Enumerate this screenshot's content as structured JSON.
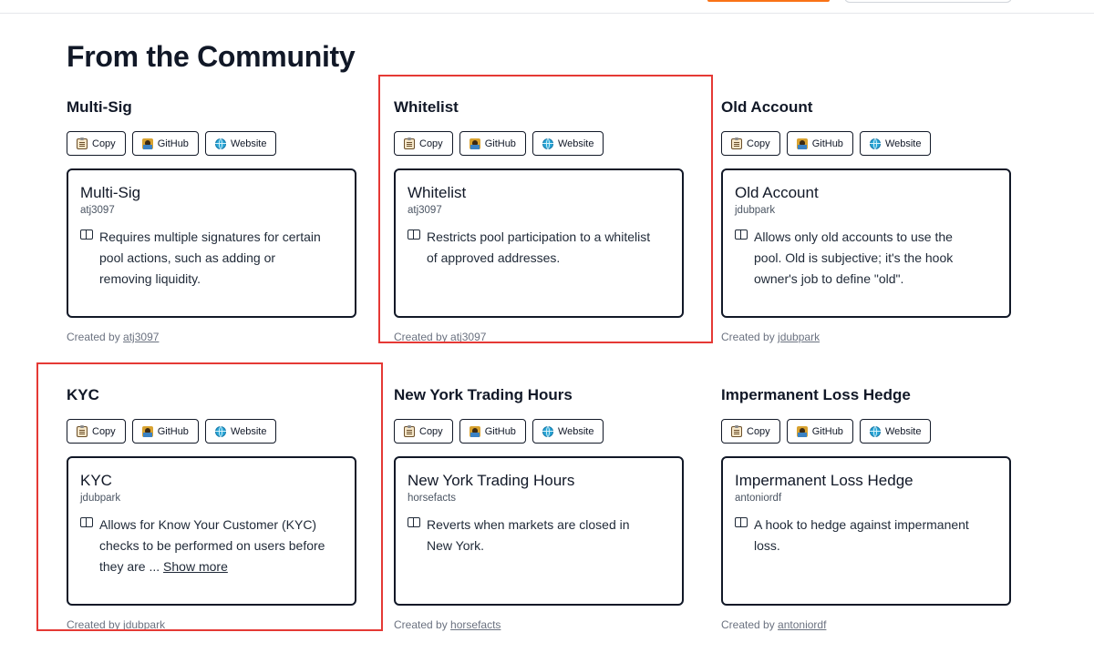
{
  "page": {
    "title": "From the Community"
  },
  "cards": [
    {
      "title": "Multi-Sig",
      "name": "Multi-Sig",
      "author": "atj3097",
      "description": "Requires multiple signatures for certain pool actions, such as adding or removing liquidity.",
      "show_more": "",
      "created_prefix": "Created by",
      "created_by": "atj3097",
      "buttons": {
        "copy": "Copy",
        "github": "GitHub",
        "website": "Website"
      }
    },
    {
      "title": "Whitelist",
      "name": "Whitelist",
      "author": "atj3097",
      "description": "Restricts pool participation to a whitelist of approved addresses.",
      "show_more": "",
      "created_prefix": "Created by",
      "created_by": "atj3097",
      "buttons": {
        "copy": "Copy",
        "github": "GitHub",
        "website": "Website"
      }
    },
    {
      "title": "Old Account",
      "name": "Old Account",
      "author": "jdubpark",
      "description": "Allows only old accounts to use the pool. Old is subjective; it's the hook owner's job to define \"old\".",
      "show_more": "",
      "created_prefix": "Created by",
      "created_by": "jdubpark",
      "buttons": {
        "copy": "Copy",
        "github": "GitHub",
        "website": "Website"
      }
    },
    {
      "title": "KYC",
      "name": "KYC",
      "author": "jdubpark",
      "description": "Allows for Know Your Customer (KYC) checks to be performed on users before they are ...",
      "show_more": "Show more",
      "created_prefix": "Created by",
      "created_by": "jdubpark",
      "buttons": {
        "copy": "Copy",
        "github": "GitHub",
        "website": "Website"
      }
    },
    {
      "title": "New York Trading Hours",
      "name": "New York Trading Hours",
      "author": "horsefacts",
      "description": "Reverts when markets are closed in New York.",
      "show_more": "",
      "created_prefix": "Created by",
      "created_by": "horsefacts",
      "buttons": {
        "copy": "Copy",
        "github": "GitHub",
        "website": "Website"
      }
    },
    {
      "title": "Impermanent Loss Hedge",
      "name": "Impermanent Loss Hedge",
      "author": "antoniordf",
      "description": "A hook to hedge against impermanent loss.",
      "show_more": "",
      "created_prefix": "Created by",
      "created_by": "antoniordf",
      "buttons": {
        "copy": "Copy",
        "github": "GitHub",
        "website": "Website"
      }
    }
  ],
  "colors": {
    "highlight": "#e53935",
    "accent": "#f97316",
    "text": "#111827",
    "muted": "#6b7280"
  },
  "icons": {
    "copy": "clipboard-icon",
    "github": "github-avatar-icon",
    "website": "globe-icon",
    "description": "book-icon"
  }
}
